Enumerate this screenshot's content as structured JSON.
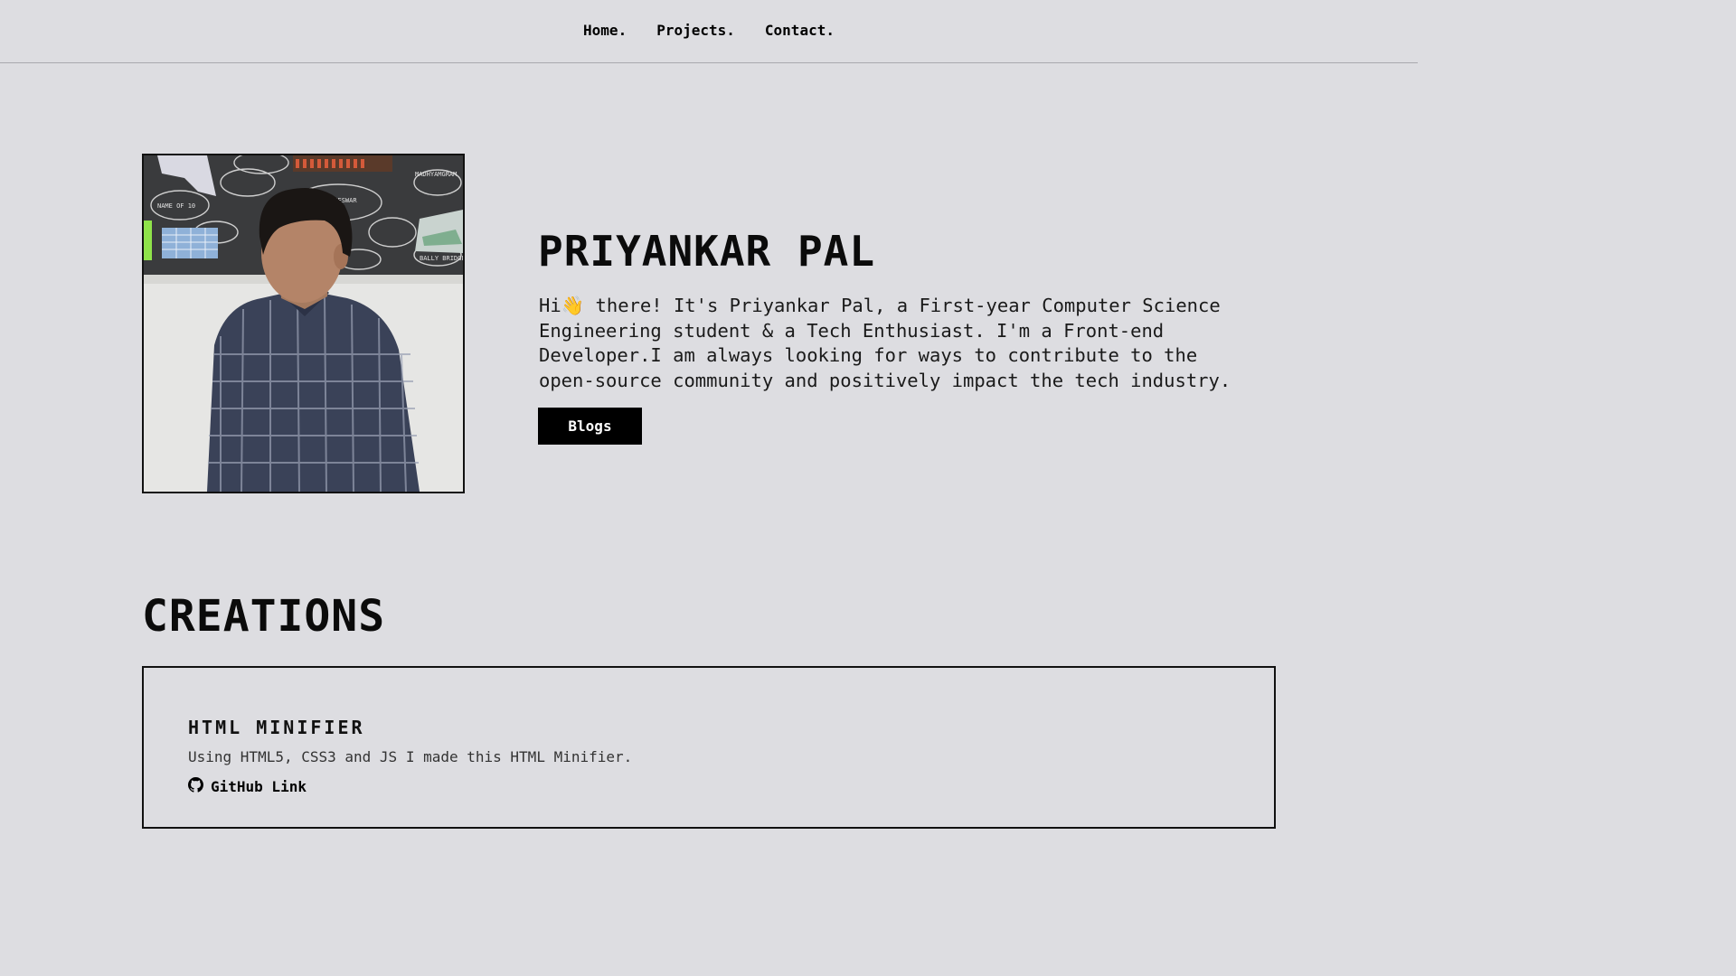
{
  "nav": {
    "items": [
      {
        "label": "Home."
      },
      {
        "label": "Projects."
      },
      {
        "label": "Contact."
      }
    ]
  },
  "hero": {
    "name": "PRIYANKAR PAL",
    "bio": "Hi👋 there! It's Priyankar Pal, a First-year Computer Science\nEngineering student & a Tech Enthusiast. I'm a Front-end\nDeveloper.I am always looking for ways to contribute to the\nopen-source community and positively impact the tech industry.",
    "button_label": "Blogs",
    "photo_signs": [
      "MADHYAMGRAM",
      "DAKSHINESWAR",
      "BALLY BRIDGE",
      "NAME OF 10"
    ]
  },
  "creations": {
    "title": "CREATIONS",
    "projects": [
      {
        "title": "HTML MINIFIER",
        "description": "Using HTML5, CSS3 and JS I made this HTML Minifier.",
        "link_label": "GitHub Link",
        "icon": "github-icon"
      }
    ]
  }
}
